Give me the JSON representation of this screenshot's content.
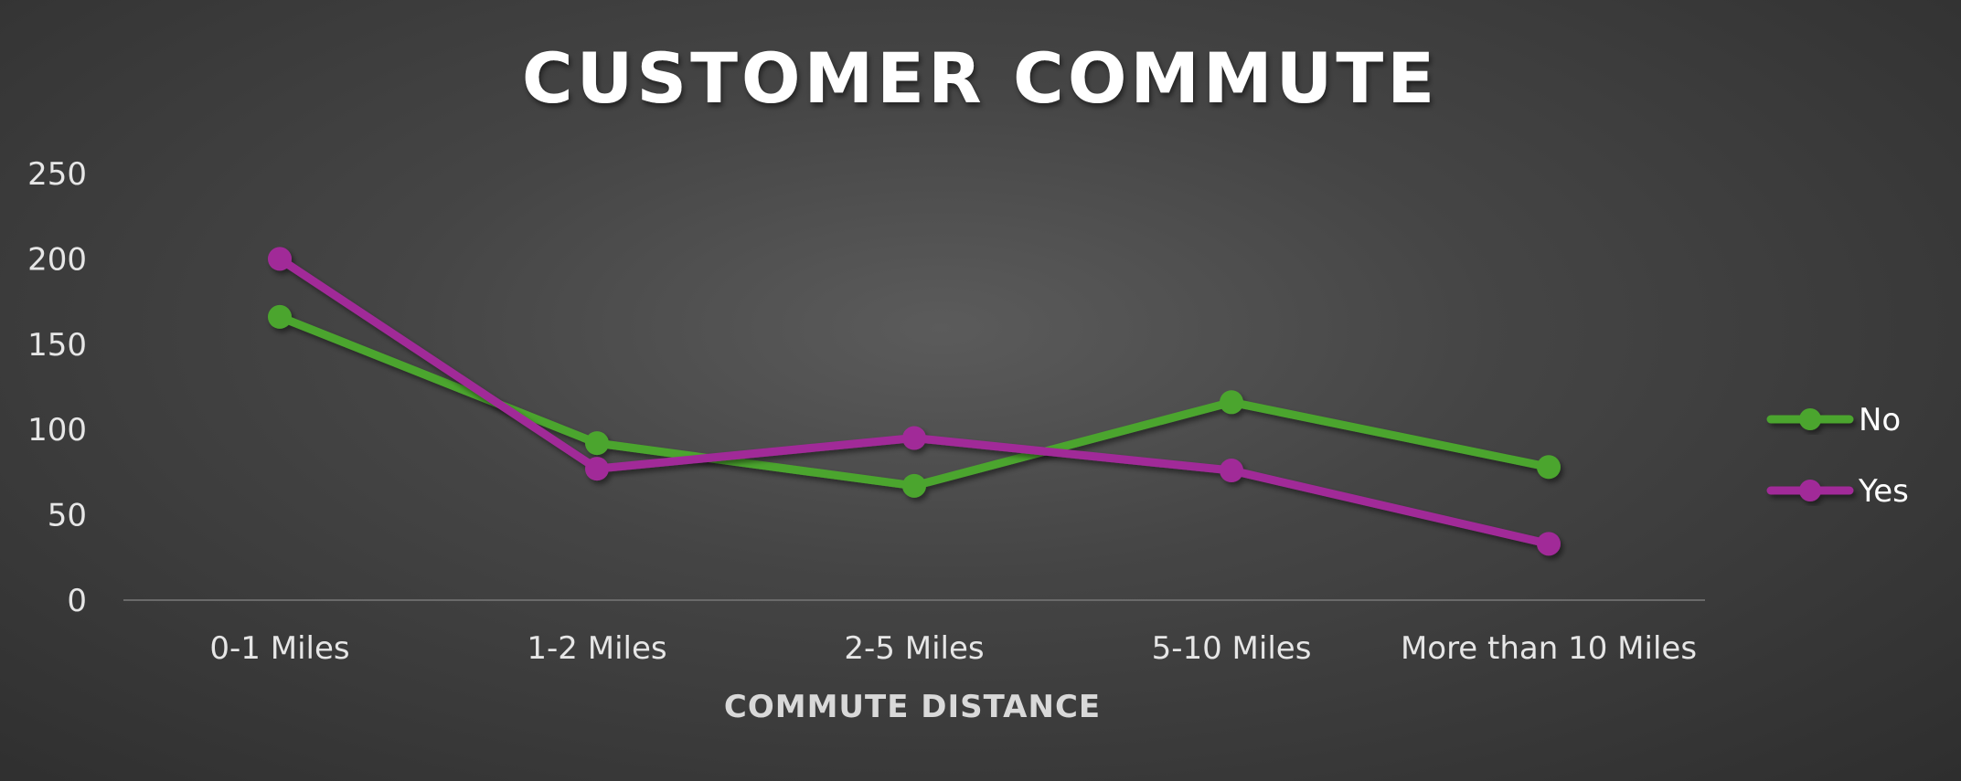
{
  "chart_data": {
    "type": "line",
    "title": "CUSTOMER COMMUTE",
    "xlabel": "COMMUTE DISTANCE",
    "ylabel": "",
    "categories": [
      "0-1 Miles",
      "1-2 Miles",
      "2-5 Miles",
      "5-10 Miles",
      "More than 10 Miles"
    ],
    "y_ticks": [
      0,
      50,
      100,
      150,
      200,
      250
    ],
    "ylim": [
      0,
      250
    ],
    "grid": false,
    "legend_position": "right",
    "series": [
      {
        "name": "No",
        "color": "#4ca52f",
        "values": [
          166,
          92,
          67,
          116,
          78
        ]
      },
      {
        "name": "Yes",
        "color": "#a12b98",
        "values": [
          200,
          77,
          95,
          76,
          33
        ]
      }
    ]
  }
}
